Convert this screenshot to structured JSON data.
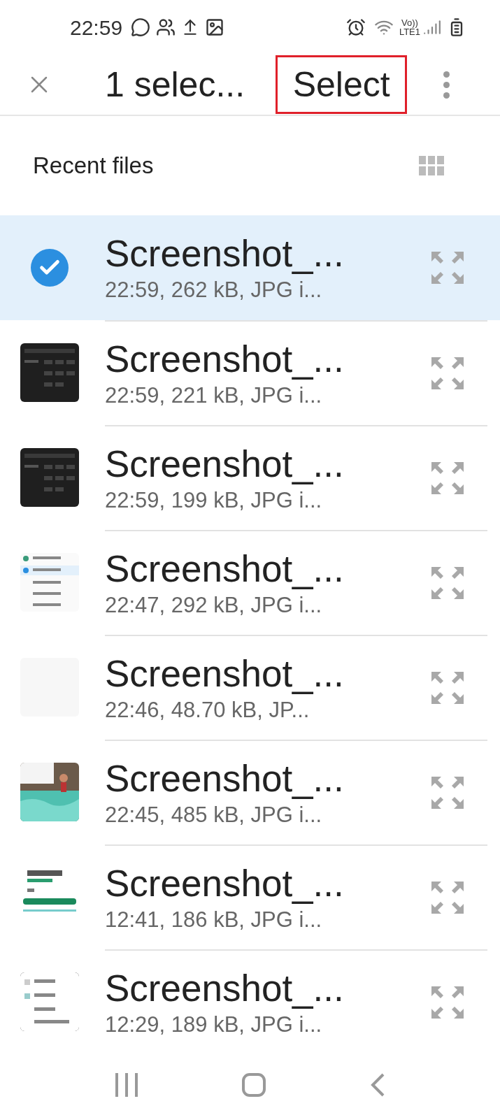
{
  "status_bar": {
    "time": "22:59",
    "network": [
      "Vo))",
      "LTE1"
    ]
  },
  "header": {
    "title": "1 selec...",
    "action": {
      "label": "Select",
      "highlighted": true
    }
  },
  "section": {
    "title": "Recent files"
  },
  "files": [
    {
      "name": "Screenshot_...",
      "details": "22:59, 262 kB, JPG i...",
      "selected": true
    },
    {
      "name": "Screenshot_...",
      "details": "22:59, 221 kB, JPG i...",
      "selected": false
    },
    {
      "name": "Screenshot_...",
      "details": "22:59, 199 kB, JPG i...",
      "selected": false
    },
    {
      "name": "Screenshot_...",
      "details": "22:47, 292 kB, JPG i...",
      "selected": false
    },
    {
      "name": "Screenshot_...",
      "details": "22:46, 48.70 kB, JP...",
      "selected": false
    },
    {
      "name": "Screenshot_...",
      "details": "22:45, 485 kB, JPG i...",
      "selected": false
    },
    {
      "name": "Screenshot_...",
      "details": "12:41, 186 kB, JPG i...",
      "selected": false
    },
    {
      "name": "Screenshot_...",
      "details": "12:29, 189 kB, JPG i...",
      "selected": false
    }
  ]
}
